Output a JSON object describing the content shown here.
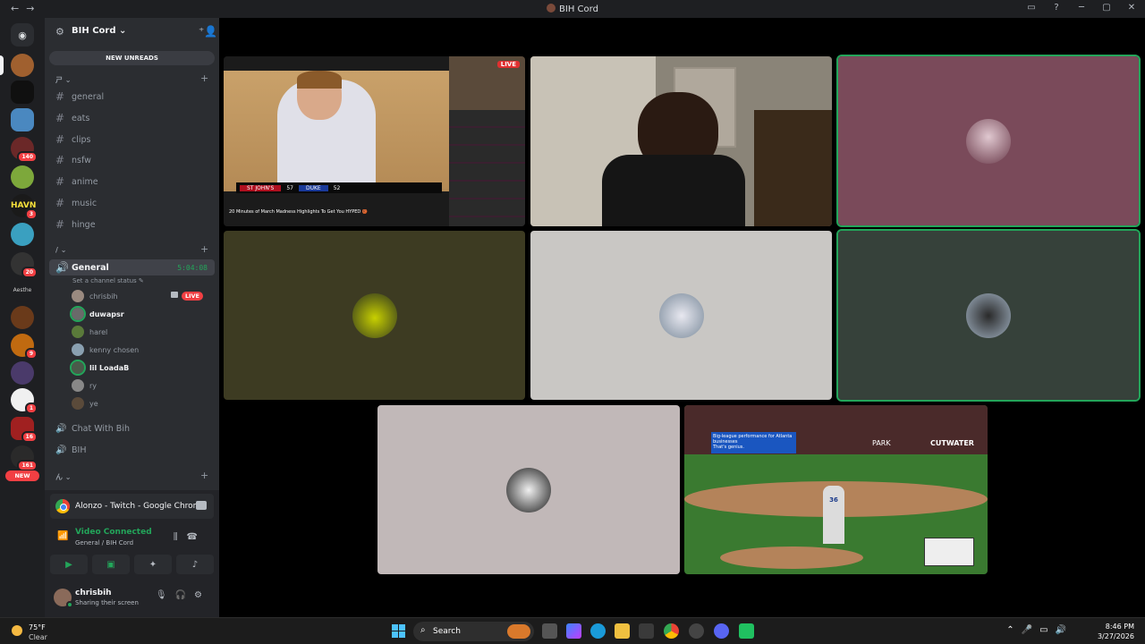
{
  "window": {
    "title": "BIH Cord"
  },
  "server": {
    "name": "BIH Cord",
    "new_unreads": "NEW UNREADS"
  },
  "categories": {
    "text": "ㄕ ⌄",
    "voice": "/ ⌄",
    "third": "ん ⌄"
  },
  "text_channels": [
    {
      "name": "general"
    },
    {
      "name": "eats"
    },
    {
      "name": "clips"
    },
    {
      "name": "nsfw"
    },
    {
      "name": "anime"
    },
    {
      "name": "music"
    },
    {
      "name": "hinge"
    }
  ],
  "voice_channel": {
    "name": "General",
    "time": "5:04:08",
    "status": "Set a channel status"
  },
  "voice_users": [
    {
      "name": "chrisbih",
      "live": "LIVE",
      "bold": false,
      "color": "#9a8a80"
    },
    {
      "name": "duwapsr",
      "bold": true,
      "color": "#6a6a6a"
    },
    {
      "name": "harel",
      "bold": false,
      "color": "#5a7a3a"
    },
    {
      "name": "kenny chosen",
      "bold": false,
      "color": "#8aa0b0"
    },
    {
      "name": "lil LoadaB",
      "bold": true,
      "color": "#4a5a4a"
    },
    {
      "name": "ry",
      "bold": false,
      "color": "#888888"
    },
    {
      "name": "ye",
      "bold": false,
      "color": "#5a4a3a"
    }
  ],
  "other_voice": [
    {
      "name": "Chat With Bih"
    },
    {
      "name": "BIH"
    }
  ],
  "guild_badges": [
    "140",
    "3",
    "20",
    "9",
    "1",
    "16",
    "161"
  ],
  "new_pill": "NEW",
  "panel": {
    "share_title": "Alonzo - Twitch - Google Chrome",
    "connected": "Video Connected",
    "connected_sub": "General / BIH Cord",
    "username": "chrisbih",
    "user_status": "Sharing their screen"
  },
  "tiles": {
    "stream_live": "LIVE",
    "stream_caption": "20 Minutes of March Madness Highlights To Get You HYPED 🏀",
    "stream_score_a": "57",
    "stream_score_b": "52",
    "baseball_ad1": "Big-league performance for Atlanta businesses",
    "baseball_ad2": "That's genius.",
    "baseball_park": "PARK",
    "baseball_sponsor": "CUTWATER",
    "baseball_number": "36",
    "colors": [
      "#7a4a5a",
      "#3d3b22",
      "#c9c7c4",
      "#36413a",
      "#c1b8b8"
    ]
  },
  "taskbar": {
    "temp": "75°F",
    "cond": "Clear",
    "search": "Search",
    "time": "8:46 PM",
    "date": "3/27/2026"
  }
}
